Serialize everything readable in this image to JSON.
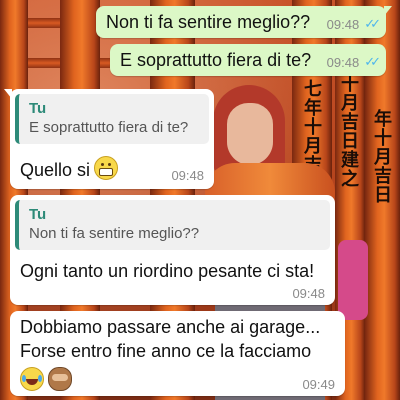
{
  "background": {
    "pillar_text": [
      "七年十月吉日",
      "十月吉日建之",
      "年十月吉日"
    ]
  },
  "messages": [
    {
      "direction": "outgoing",
      "text": "Non ti fa sentire meglio??",
      "time": "09:48",
      "status": "read"
    },
    {
      "direction": "outgoing",
      "text": "E soprattutto fiera di te?",
      "time": "09:48",
      "status": "read"
    },
    {
      "direction": "incoming",
      "quote": {
        "author": "Tu",
        "text": "E soprattutto fiera di te?"
      },
      "text": "Quello si",
      "emoji": [
        "grimacing-face"
      ],
      "time": "09:48"
    },
    {
      "direction": "incoming",
      "quote": {
        "author": "Tu",
        "text": "Non ti fa sentire meglio??"
      },
      "text": "Ogni tanto un riordino pesante ci sta!",
      "time": "09:48"
    },
    {
      "direction": "incoming",
      "text_lines": [
        "Dobbiamo passare anche ai garage...",
        "Forse entro fine anno ce la facciamo"
      ],
      "emoji": [
        "face-with-tears-of-joy",
        "see-no-evil-monkey"
      ],
      "time": "09:49"
    }
  ],
  "colors": {
    "outgoing_bubble": "#dcf8c6",
    "incoming_bubble": "#ffffff",
    "quote_accent": "#2d8a78",
    "read_ticks": "#4fb6ec"
  }
}
